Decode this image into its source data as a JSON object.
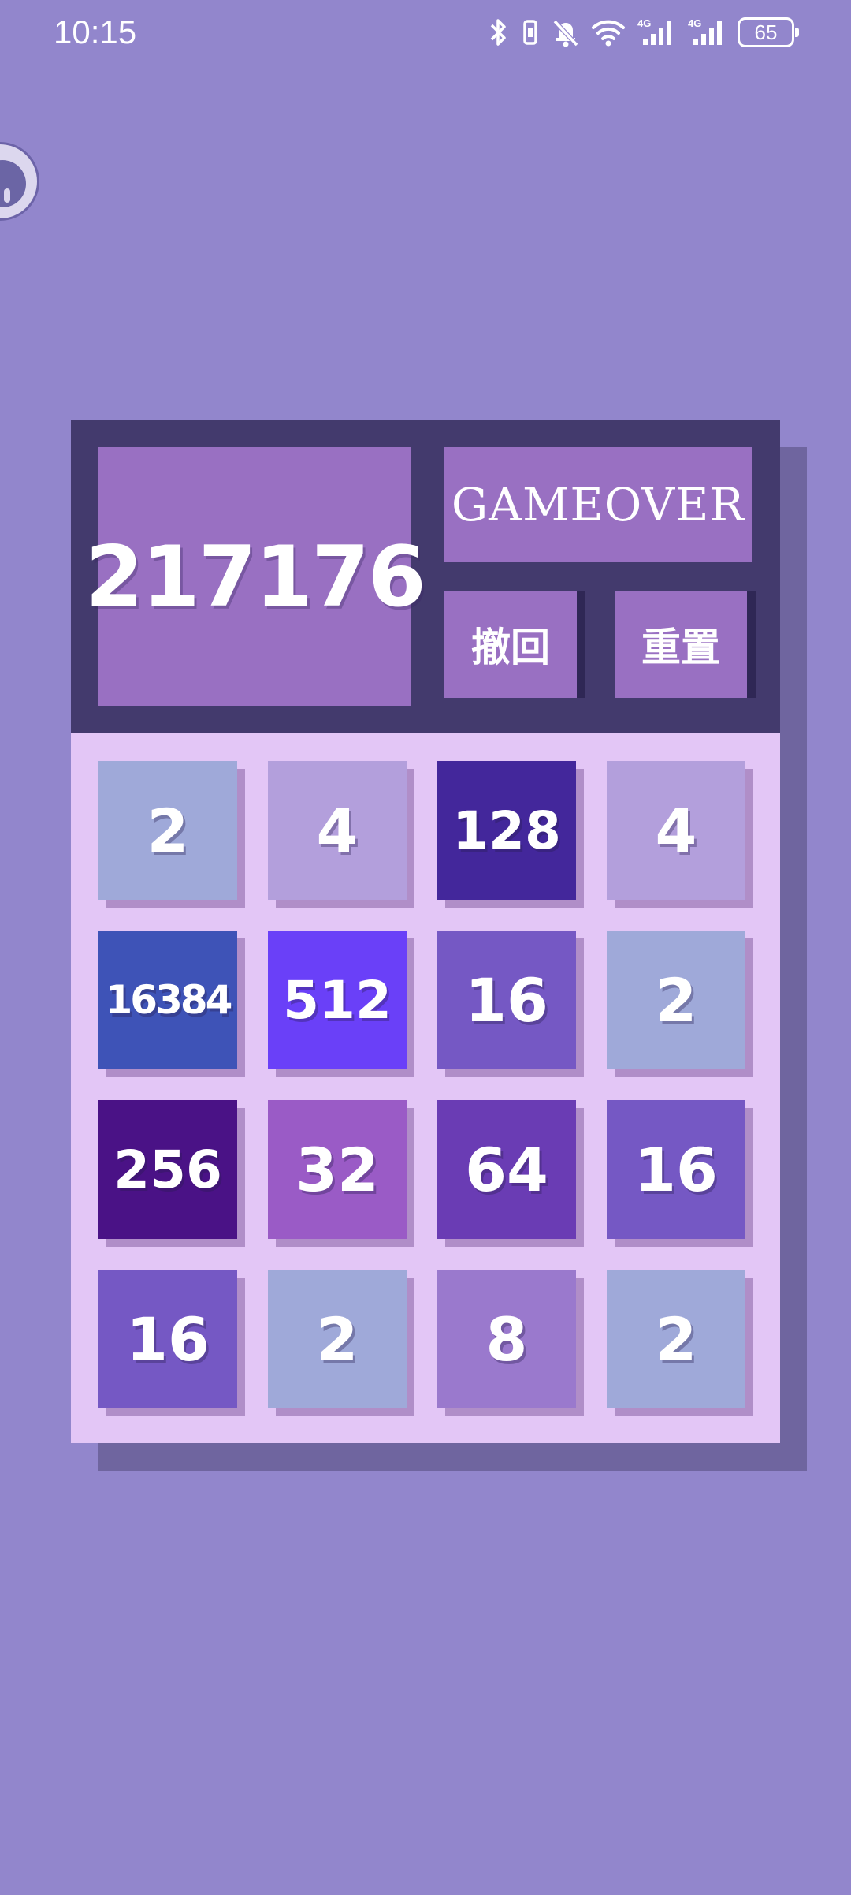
{
  "status_bar": {
    "time": "10:15",
    "battery": "65",
    "icons": [
      "bluetooth-icon",
      "vibrate-icon",
      "bell-off-icon",
      "wifi-icon",
      "signal-4g-icon",
      "signal-4g-icon",
      "battery-icon"
    ]
  },
  "game": {
    "score": "217176",
    "status": "GAMEOVER",
    "undo_label": "撤回",
    "reset_label": "重置",
    "tiles": [
      [
        "2",
        "4",
        "128",
        "4"
      ],
      [
        "16384",
        "512",
        "16",
        "2"
      ],
      [
        "256",
        "32",
        "64",
        "16"
      ],
      [
        "16",
        "2",
        "8",
        "2"
      ]
    ]
  },
  "colors": {
    "background": "#9286cc",
    "header": "#433a6d",
    "panel": "#9970c2",
    "board": "#e3c6f6",
    "tile_2": "#9fa9d9",
    "tile_4": "#b39fdc",
    "tile_8": "#9a79cd",
    "tile_16": "#7558c4",
    "tile_32": "#9a5bc6",
    "tile_64": "#6a3cb4",
    "tile_128": "#43279b",
    "tile_256": "#4a1286",
    "tile_512": "#6a40f8",
    "tile_16384": "#3e53b7"
  }
}
